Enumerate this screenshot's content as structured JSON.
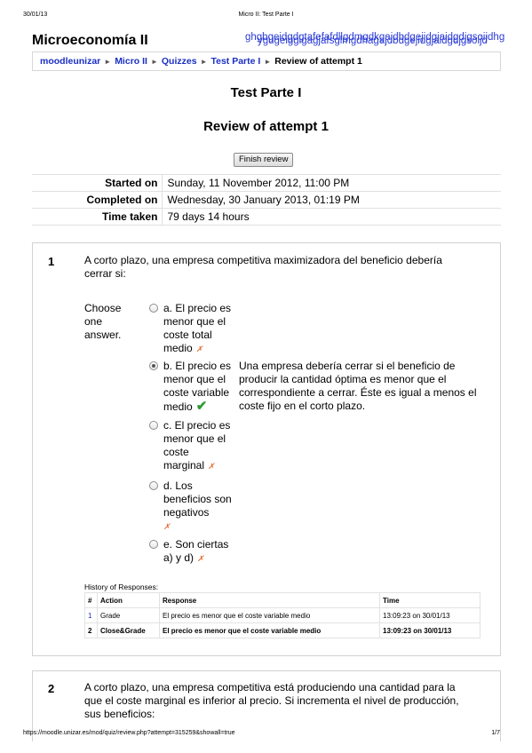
{
  "print_header": {
    "date": "30/01/13",
    "title": "Micro II: Test Parte I"
  },
  "site": {
    "name": "Microeconomía II",
    "garbled_line1": "ghgbgeidgdgtafefafdllgdmgdkgajdbdgejidgjaidgdjgsoijdhg",
    "garbled_line2": "ygugeiggigagjafsglmgdhagajdbdgejidgjaidgdjgsoijd"
  },
  "breadcrumb": {
    "items": [
      "moodleunizar",
      "Micro II",
      "Quizzes",
      "Test Parte I"
    ],
    "current": "Review of attempt 1",
    "separator": "►"
  },
  "quiz_title": "Test Parte I",
  "review_title": "Review of attempt 1",
  "finish_button": "Finish review",
  "summary": {
    "started_label": "Started on",
    "started_value": "Sunday, 11 November 2012, 11:00 PM",
    "completed_label": "Completed on",
    "completed_value": "Wednesday, 30 January 2013, 01:19 PM",
    "taken_label": "Time taken",
    "taken_value": "79 days 14 hours"
  },
  "question1": {
    "number": "1",
    "text": "A corto plazo, una empresa competitiva maximizadora del beneficio debería cerrar si:",
    "prompt": "Choose one answer.",
    "options": [
      {
        "text": "a. El precio es menor que el coste total medio",
        "mark": "✗",
        "selected": false
      },
      {
        "text": "b. El precio es menor que el coste variable medio",
        "mark": "✔",
        "selected": true
      },
      {
        "text": "c. El precio es menor que el coste marginal",
        "mark": "✗",
        "selected": false
      },
      {
        "text": "d. Los beneficios son negativos",
        "mark": "✗",
        "selected": false
      },
      {
        "text": "e. Son ciertas a) y d)",
        "mark": "✗",
        "selected": false
      }
    ],
    "feedback": "Una empresa debería cerrar si el beneficio de producir la cantidad óptima es menor que el correspondiente a cerrar. Éste es igual a menos el coste fijo en el corto plazo.",
    "history": {
      "label": "History of Responses:",
      "headers": [
        "#",
        "Action",
        "Response",
        "Time"
      ],
      "rows": [
        {
          "num": "1",
          "action": "Grade",
          "response": "El precio es menor que el coste variable medio",
          "time": "13:09:23 on 30/01/13"
        },
        {
          "num": "2",
          "action": "Close&Grade",
          "response": "El precio es menor que el coste variable medio",
          "time": "13:09:23 on 30/01/13"
        }
      ]
    }
  },
  "question2": {
    "number": "2",
    "text": "A corto plazo, una empresa competitiva está produciendo una cantidad para la que el coste marginal es inferior al precio. Si incrementa el nivel de producción, sus beneficios:"
  },
  "print_footer": {
    "url": "https://moodle.unizar.es/mod/quiz/review.php?attempt=315259&showall=true",
    "page": "1/7"
  }
}
